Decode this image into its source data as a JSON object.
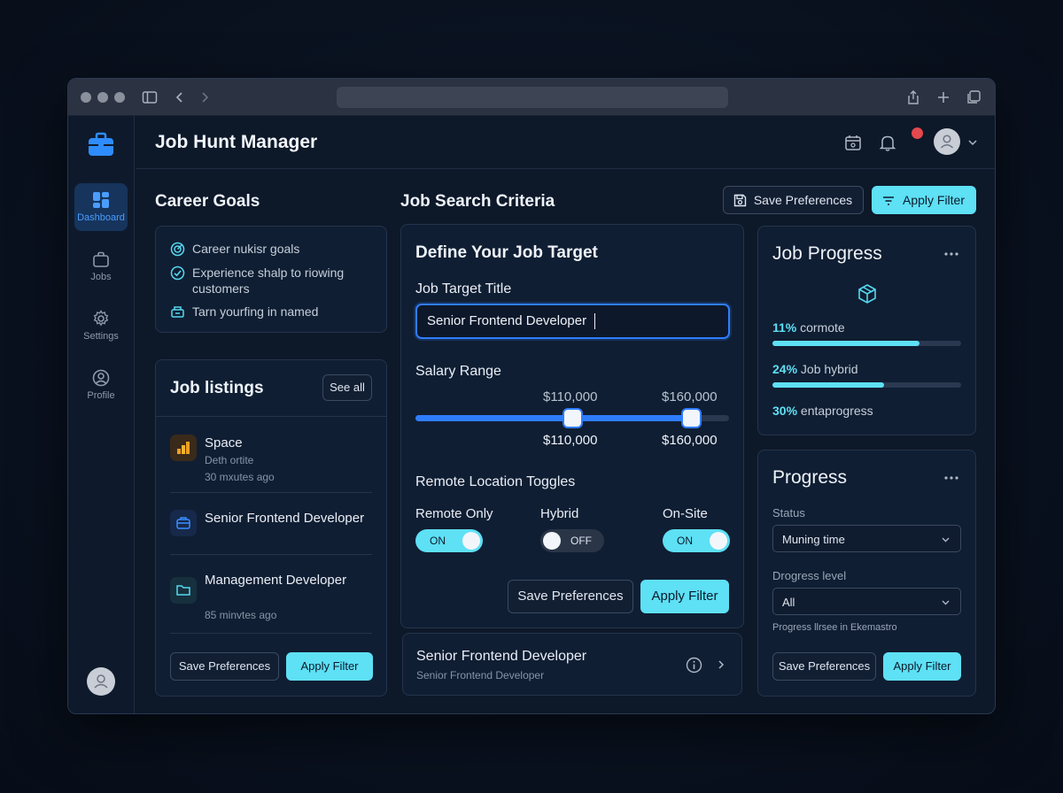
{
  "app": {
    "title": "Job Hunt Manager"
  },
  "sidebar": {
    "items": [
      {
        "label": "Dashboard",
        "icon": "dashboard-icon",
        "active": true
      },
      {
        "label": "Jobs",
        "icon": "briefcase-icon"
      },
      {
        "label": "Settings",
        "icon": "gear-icon"
      },
      {
        "label": "Profile",
        "icon": "user-icon"
      }
    ]
  },
  "career_goals": {
    "title": "Career Goals",
    "items": [
      {
        "text": "Career nukisr goals",
        "icon": "target-icon"
      },
      {
        "text": "Experience shalp to riowing customers",
        "icon": "check-circle-icon"
      },
      {
        "text": "Tarn yourfing in named",
        "icon": "award-icon"
      }
    ]
  },
  "job_listings": {
    "title": "Job listings",
    "see_all": "See all",
    "items": [
      {
        "title": "Space",
        "subtitle": "Deth ortite",
        "time": "30 mxutes ago"
      },
      {
        "title": "Senior Frontend Developer"
      },
      {
        "title": "Management Developer",
        "time": "85 minvtes ago"
      }
    ],
    "save_label": "Save Preferences",
    "apply_label": "Apply Filter"
  },
  "criteria": {
    "title": "Job Search Criteria",
    "save_label": "Save Preferences",
    "apply_label": "Apply Filter",
    "card_title": "Define Your Job Target",
    "target_label": "Job Target Title",
    "target_value": "Senior Frontend Developer",
    "salary_label": "Salary Range",
    "salary_min": "$110,000",
    "salary_max": "$160,000",
    "salary_min_fraction": 0.5,
    "salary_max_fraction": 0.88,
    "toggles_label": "Remote Location Toggles",
    "toggles": [
      {
        "label": "Remote Only",
        "state": "ON"
      },
      {
        "label": "Hybrid",
        "state": "OFF"
      },
      {
        "label": "On-Site",
        "state": "ON"
      }
    ],
    "card_save_label": "Save Preferences",
    "card_apply_label": "Apply Filter"
  },
  "result_row": {
    "title": "Senior Frontend Developer",
    "subtitle": "Senior Frontend Developer"
  },
  "job_progress": {
    "title": "Job Progress",
    "items": [
      {
        "pct": "11%",
        "text": "cormote",
        "fraction": 0.78
      },
      {
        "pct": "24%",
        "text": "Job hybrid",
        "fraction": 0.59
      },
      {
        "pct": "30%",
        "text": "entaprogress"
      }
    ]
  },
  "progress": {
    "title": "Progress",
    "status_label": "Status",
    "status_value": "Muning time",
    "level_label": "Drogress level",
    "level_value": "All",
    "note": "Progress llrsee in Ekemastro",
    "save_label": "Save Preferences",
    "apply_label": "Apply Filter"
  },
  "colors": {
    "accent": "#5ee0f5",
    "brand": "#2f8cff",
    "notification": "#e5484d",
    "background": "#0d1829"
  }
}
